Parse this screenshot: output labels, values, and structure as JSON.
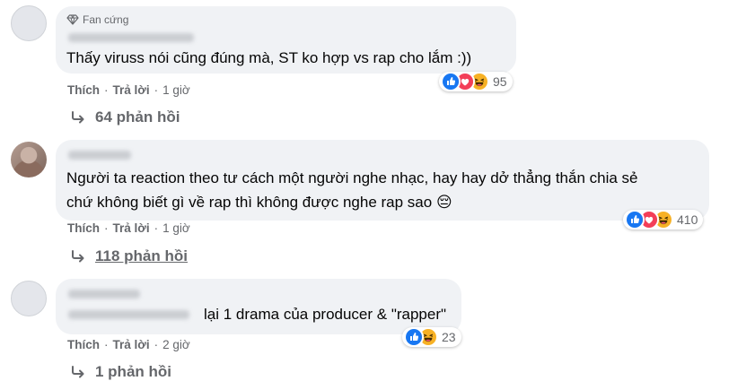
{
  "comments": [
    {
      "badge": "Fan cứng",
      "text": [
        "Thấy viruss nói cũng đúng mà, ST ko hợp vs rap cho lắm :))"
      ],
      "like": "Thích",
      "reply": "Trả lời",
      "time": "1 giờ",
      "reaction_count": "95",
      "reactions": [
        "like-icon",
        "love-icon",
        "haha-icon"
      ],
      "replies": "64 phản hồi"
    },
    {
      "text": [
        "Người ta reaction theo tư cách một người nghe nhạc, hay hay dở thẳng thắn chia sẻ",
        "chứ không biết gì về rap thì không được nghe rap sao 😔"
      ],
      "like": "Thích",
      "reply": "Trả lời",
      "time": "1 giờ",
      "reaction_count": "410",
      "reactions": [
        "like-icon",
        "love-icon",
        "haha-icon"
      ],
      "replies": "118 phản hồi"
    },
    {
      "text": [
        "lại 1 drama của producer & \"rapper\""
      ],
      "like": "Thích",
      "reply": "Trả lời",
      "time": "2 giờ",
      "reaction_count": "23",
      "reactions": [
        "like-icon",
        "haha-icon"
      ],
      "replies": "1 phản hồi"
    }
  ],
  "colors": {
    "bubble": "#f0f2f5",
    "secondary_text": "#65676b",
    "like_blue": "#1877f2",
    "love_red": "#f33e58",
    "haha_yellow": "#f7b125"
  }
}
